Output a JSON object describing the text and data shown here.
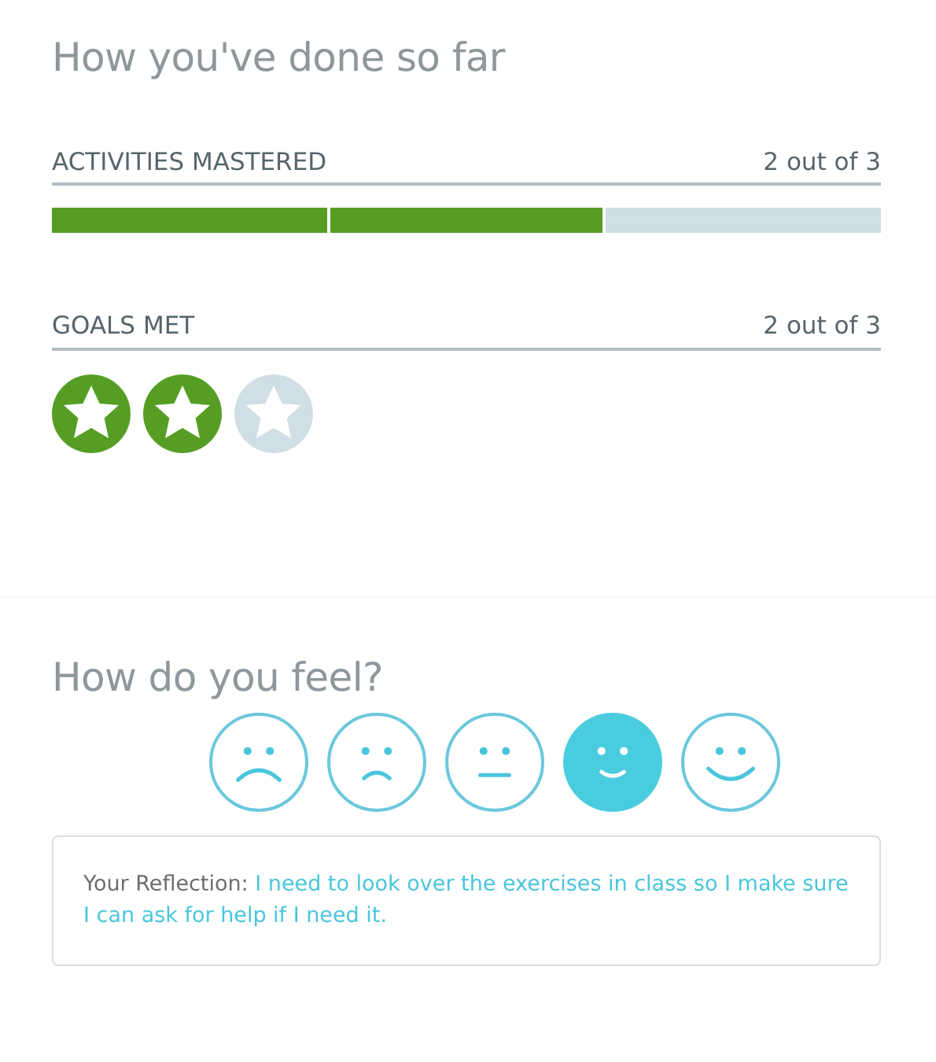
{
  "progress": {
    "title": "How you've done so far",
    "activities": {
      "label": "ACTIVITIES MASTERED",
      "count": "2 out of 3",
      "level": 0.667
    },
    "goals": {
      "label": "GOALS MET",
      "count": "2 out of 3",
      "badges": [
        {
          "met": true
        },
        {
          "met": true
        },
        {
          "met": false
        }
      ]
    }
  },
  "feelings": {
    "title": "How do you feel?",
    "moods": [
      {
        "kind": "sad",
        "selected": false
      },
      {
        "kind": "unhappy",
        "selected": false
      },
      {
        "kind": "neutral",
        "selected": false
      },
      {
        "kind": "content",
        "selected": true
      },
      {
        "kind": "happy",
        "selected": false
      }
    ],
    "reflection": {
      "label": "Your Reflection:",
      "text": "I need to look over the exercises in class so I make sure I can ask for help if I need it."
    }
  }
}
